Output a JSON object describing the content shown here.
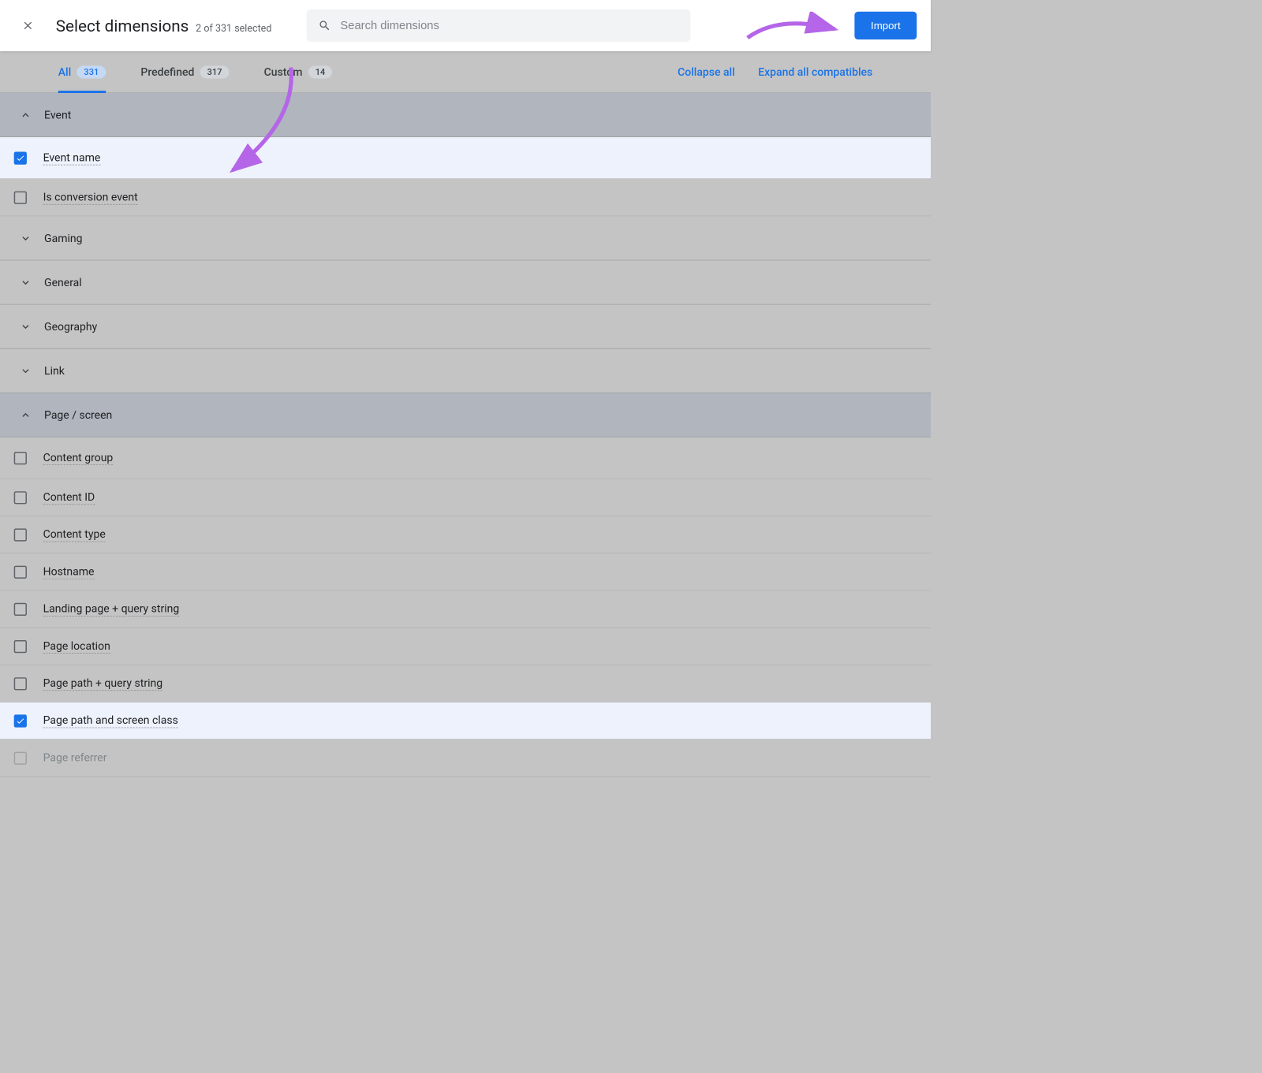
{
  "header": {
    "title": "Select dimensions",
    "subtitle": "2 of 331 selected",
    "search_placeholder": "Search dimensions",
    "import_label": "Import"
  },
  "tabs": {
    "all": {
      "label": "All",
      "count": "331"
    },
    "predefined": {
      "label": "Predefined",
      "count": "317"
    },
    "custom": {
      "label": "Custom",
      "count": "14"
    },
    "collapse": "Collapse all",
    "expand": "Expand all compatibles"
  },
  "groups": [
    {
      "label": "Event",
      "expanded": true,
      "items": [
        {
          "label": "Event name",
          "checked": true,
          "highlight": true
        },
        {
          "label": "Is conversion event",
          "checked": false
        }
      ]
    },
    {
      "label": "Gaming",
      "expanded": false,
      "items": []
    },
    {
      "label": "General",
      "expanded": false,
      "items": []
    },
    {
      "label": "Geography",
      "expanded": false,
      "items": []
    },
    {
      "label": "Link",
      "expanded": false,
      "items": []
    },
    {
      "label": "Page / screen",
      "expanded": true,
      "items": [
        {
          "label": "Content group",
          "checked": false
        },
        {
          "label": "Content ID",
          "checked": false
        },
        {
          "label": "Content type",
          "checked": false
        },
        {
          "label": "Hostname",
          "checked": false
        },
        {
          "label": "Landing page + query string",
          "checked": false
        },
        {
          "label": "Page location",
          "checked": false
        },
        {
          "label": "Page path + query string",
          "checked": false
        },
        {
          "label": "Page path and screen class",
          "checked": true,
          "highlight": true
        },
        {
          "label": "Page referrer",
          "checked": false,
          "disabled": true
        }
      ]
    }
  ]
}
